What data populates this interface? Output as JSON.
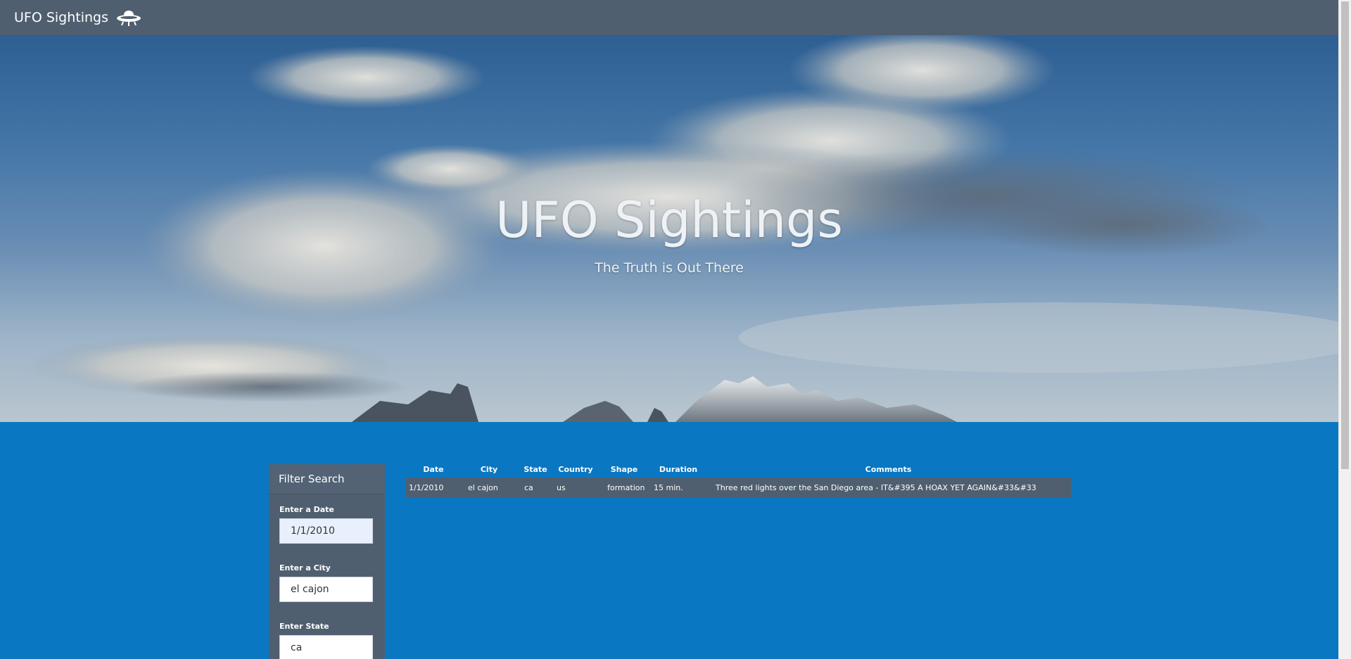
{
  "navbar": {
    "brand": "UFO Sightings",
    "brand_icon": "ufo-icon"
  },
  "hero": {
    "title": "UFO Sightings",
    "subtitle": "The Truth is Out There"
  },
  "filter": {
    "header": "Filter Search",
    "fields": [
      {
        "label": "Enter a Date",
        "value": "1/1/2010"
      },
      {
        "label": "Enter a City",
        "value": "el cajon"
      },
      {
        "label": "Enter State",
        "value": "ca"
      }
    ]
  },
  "table": {
    "headers": [
      "Date",
      "City",
      "State",
      "Country",
      "Shape",
      "Duration",
      "Comments"
    ],
    "rows": [
      [
        "1/1/2010",
        "el cajon",
        "ca",
        "us",
        "formation",
        "15 min.",
        "Three red lights over the San Diego area - IT&#395 A HOAX YET AGAIN&#33&#33"
      ]
    ]
  },
  "colors": {
    "navbar": "#4f5f70",
    "main_bg": "#0a77c2",
    "panel": "#4f5f70"
  }
}
